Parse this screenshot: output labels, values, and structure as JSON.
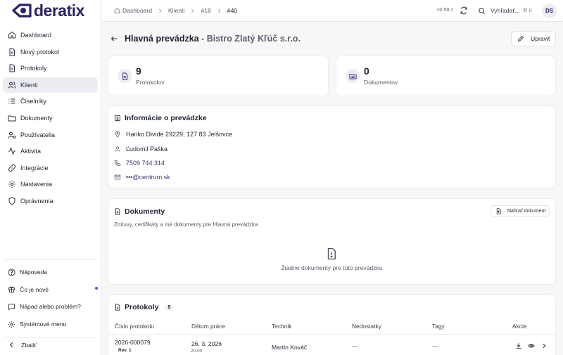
{
  "app": {
    "logo_text": "deratix",
    "version": "v0.59.1"
  },
  "nav": [
    {
      "label": "Dashboard",
      "icon": "home-icon"
    },
    {
      "label": "Nový protokol",
      "icon": "file-plus-icon"
    },
    {
      "label": "Protokoly",
      "icon": "file-text-icon"
    },
    {
      "label": "Klienti",
      "icon": "users-icon",
      "active": true
    },
    {
      "label": "Číselníky",
      "icon": "list-icon"
    },
    {
      "label": "Dokumenty",
      "icon": "folder-icon"
    },
    {
      "label": "Používatelia",
      "icon": "user-cog-icon"
    },
    {
      "label": "Aktivita",
      "icon": "activity-icon"
    },
    {
      "label": "Integrácie",
      "icon": "link-icon"
    },
    {
      "label": "Nastavenia",
      "icon": "settings-icon"
    },
    {
      "label": "Oprávnenia",
      "icon": "shield-icon"
    }
  ],
  "sidebar_bottom": [
    {
      "label": "Nápoveda",
      "icon": "help-icon"
    },
    {
      "label": "Čo je nové",
      "icon": "gift-icon"
    },
    {
      "label": "Nápad alebo problém?",
      "icon": "message-icon"
    },
    {
      "label": "Systémové menu",
      "icon": "gear-icon"
    }
  ],
  "collapse_label": "Zbaliť",
  "breadcrumbs": [
    "Dashboard",
    "Klienti",
    "#18",
    "#40"
  ],
  "search": {
    "placeholder": "Vyhľadať...",
    "shortcut": "⌘ K"
  },
  "user": {
    "initials": "DS"
  },
  "page": {
    "title": "Hlavná prevádzka",
    "subtitle": " - Bistro Zlatý Kľúč s.r.o.",
    "edit_label": "Upraviť"
  },
  "stats": [
    {
      "value": "9",
      "label": "Protokolov",
      "icon": "file-text-icon"
    },
    {
      "value": "0",
      "label": "Dokumentov",
      "icon": "folder-icon"
    }
  ],
  "info": {
    "title": "Informácie o prevádzke",
    "address": "Hanko Divide 29229, 127 83 Jelšovce",
    "person": "Ľudomil Paška",
    "phone": "7509 744 314",
    "email": "•••@centrum.sk"
  },
  "documents": {
    "title": "Dokumenty",
    "upload_label": "Nahrať dokument",
    "description": "Zmluvy, certifikáty a iné dokumenty pre Hlavná prevádzka",
    "empty_text": "Žiadne dokumenty pre túto prevádzku"
  },
  "protocols": {
    "title": "Protokoly",
    "count": "9",
    "columns": [
      "Číslo protokolu",
      "Dátum práce",
      "Technik",
      "Nedostatky",
      "Tagy",
      "Akcie"
    ],
    "rows": [
      {
        "number": "2026-000079",
        "rev": "Rev. 1",
        "date": "26. 3. 2026",
        "time": "20:00",
        "technician": "Martin Kováč",
        "deficiencies": "—",
        "tags": "—"
      }
    ]
  }
}
